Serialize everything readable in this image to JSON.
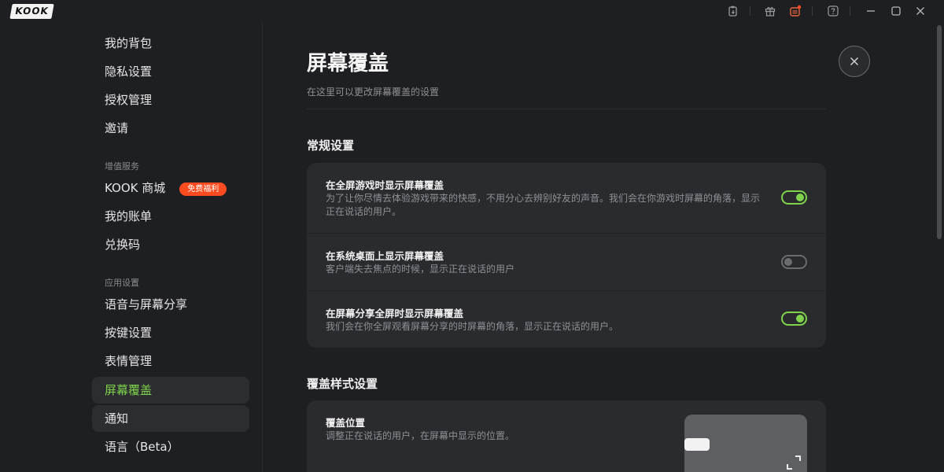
{
  "app": {
    "logo_text": "KOOK"
  },
  "titlebar": {
    "icons": [
      "clipboard-icon",
      "gift-icon",
      "notification-box-icon",
      "help-icon",
      "minimize-icon",
      "maximize-icon",
      "close-icon"
    ]
  },
  "sidebar": {
    "top_items": [
      {
        "label": "我的背包"
      },
      {
        "label": "隐私设置"
      },
      {
        "label": "授权管理"
      },
      {
        "label": "邀请"
      }
    ],
    "group_value_services": "增值服务",
    "value_items": [
      {
        "label": "KOOK 商城",
        "badge": "免费福利"
      },
      {
        "label": "我的账单"
      },
      {
        "label": "兑换码"
      }
    ],
    "group_app_settings": "应用设置",
    "app_items": [
      {
        "label": "语音与屏幕分享"
      },
      {
        "label": "按键设置"
      },
      {
        "label": "表情管理"
      },
      {
        "label": "屏幕覆盖",
        "active": true
      },
      {
        "label": "通知"
      },
      {
        "label": "语言（Beta）"
      }
    ]
  },
  "main": {
    "title": "屏幕覆盖",
    "subtitle": "在这里可以更改屏幕覆盖的设置",
    "general_section": {
      "title": "常规设置",
      "rows": [
        {
          "title": "在全屏游戏时显示屏幕覆盖",
          "desc": "为了让你尽情去体验游戏带来的快感，不用分心去辨别好友的声音。我们会在你游戏时屏幕的角落，显示正在说话的用户。",
          "enabled": true
        },
        {
          "title": "在系统桌面上显示屏幕覆盖",
          "desc": "客户端失去焦点的时候，显示正在说话的用户",
          "enabled": false
        },
        {
          "title": "在屏幕分享全屏时显示屏幕覆盖",
          "desc": "我们会在你全屏观看屏幕分享的时屏幕的角落，显示正在说话的用户。",
          "enabled": true
        }
      ]
    },
    "style_section": {
      "title": "覆盖样式设置",
      "position": {
        "title": "覆盖位置",
        "desc": "调整正在说话的用户，在屏幕中显示的位置。"
      }
    }
  },
  "colors": {
    "accent": "#7fd34c",
    "badge": "#ff4b1f",
    "background": "#1e1f22",
    "card": "#2a2b2f"
  }
}
